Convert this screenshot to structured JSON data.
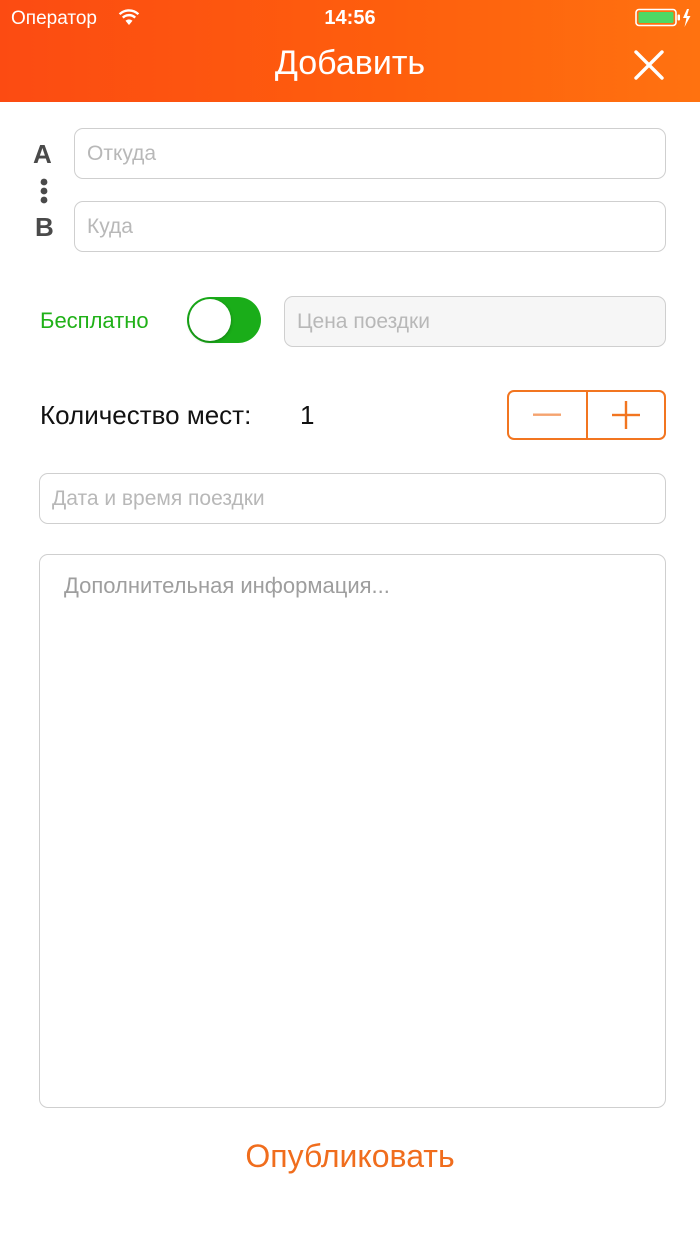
{
  "status_bar": {
    "carrier": "Оператор",
    "time": "14:56",
    "wifi_icon": "wifi-icon",
    "battery_icon": "battery-charging-icon"
  },
  "nav": {
    "title": "Добавить",
    "close_icon": "close-icon"
  },
  "route": {
    "from_marker": "A",
    "to_marker": "B",
    "from_placeholder": "Откуда",
    "to_placeholder": "Куда"
  },
  "price": {
    "free_label": "Бесплатно",
    "free_enabled": true,
    "price_placeholder": "Цена поездки"
  },
  "seats": {
    "label": "Количество мест:",
    "value": "1"
  },
  "date": {
    "placeholder": "Дата и время поездки"
  },
  "info": {
    "placeholder": "Дополнительная информация..."
  },
  "actions": {
    "publish_label": "Опубликовать"
  },
  "colors": {
    "header_gradient_start": "#fc4b12",
    "header_gradient_end": "#ff7210",
    "toggle_on": "#1aad19",
    "free_label": "#20b118",
    "accent_orange": "#f06d1d"
  }
}
